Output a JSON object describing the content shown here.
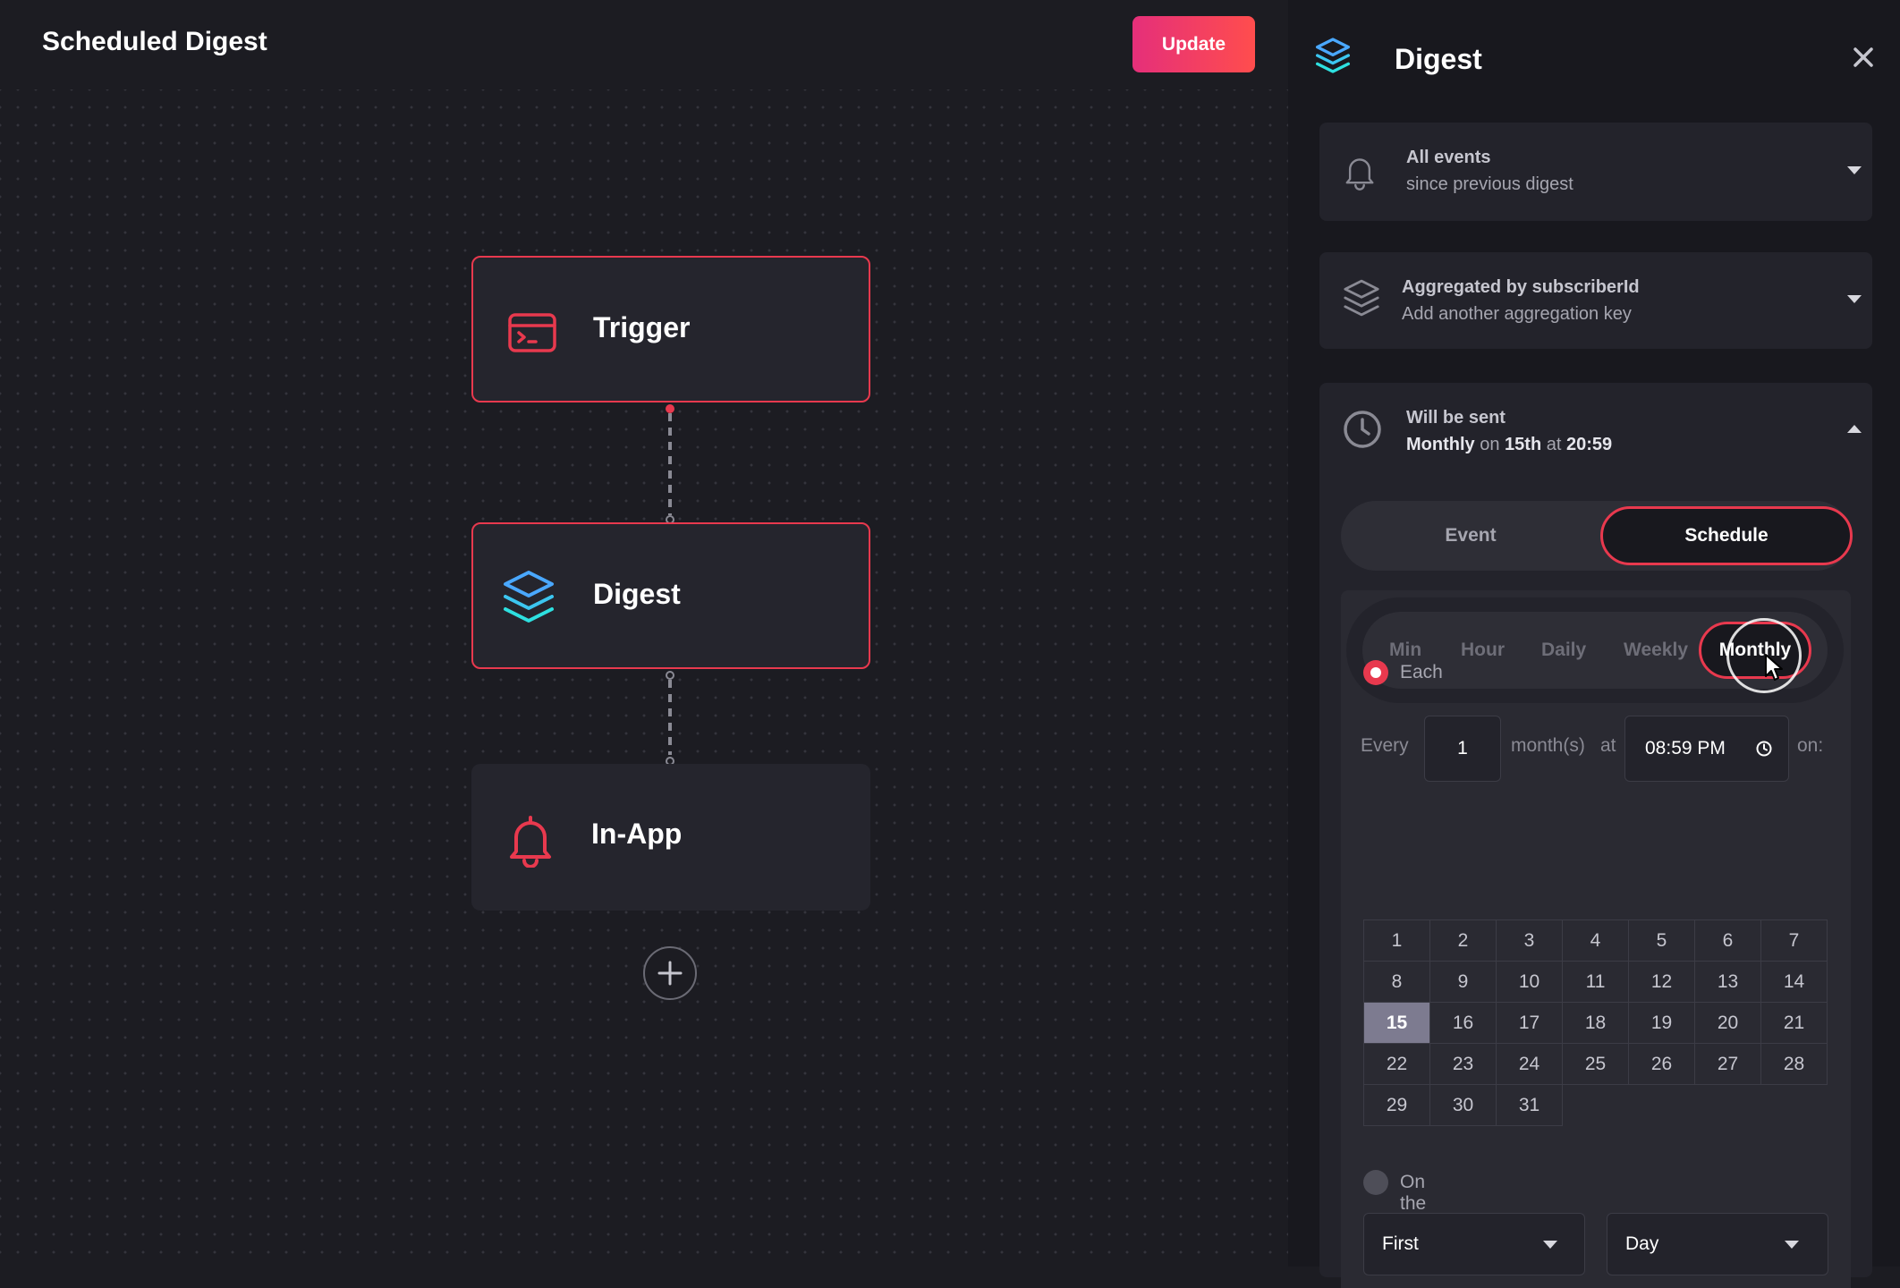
{
  "header": {
    "title": "Scheduled Digest",
    "update_label": "Update"
  },
  "workflow": {
    "nodes": [
      {
        "label": "Trigger",
        "icon": "terminal-icon"
      },
      {
        "label": "Digest",
        "icon": "layers-icon"
      },
      {
        "label": "In-App",
        "icon": "bell-icon"
      }
    ],
    "add_step_icon": "plus-icon"
  },
  "panel": {
    "title": "Digest",
    "icon": "layers-icon",
    "close_icon": "close-icon",
    "events": {
      "title": "All events",
      "subtitle": "since previous digest"
    },
    "aggregation": {
      "title": "Aggregated by subscriberId",
      "subtitle": "Add another aggregation key"
    },
    "schedule": {
      "title": "Will be sent",
      "summary": {
        "frequency": "Monthly",
        "on_word": "on",
        "day": "15th",
        "at_word": "at",
        "time": "20:59"
      },
      "mode_options": [
        "Event",
        "Schedule"
      ],
      "selected_mode": "Schedule",
      "frequencies": [
        "Min",
        "Hour",
        "Daily",
        "Weekly",
        "Monthly"
      ],
      "selected_frequency": "Monthly",
      "every_label": "Every",
      "every_value": "1",
      "unit_label": "month(s)",
      "at_label": "at",
      "time_value": "08:59 PM",
      "on_label": "on:",
      "each_label": "Each",
      "days": [
        "1",
        "2",
        "3",
        "4",
        "5",
        "6",
        "7",
        "8",
        "9",
        "10",
        "11",
        "12",
        "13",
        "14",
        "15",
        "16",
        "17",
        "18",
        "19",
        "20",
        "21",
        "22",
        "23",
        "24",
        "25",
        "26",
        "27",
        "28",
        "29",
        "30",
        "31"
      ],
      "selected_day": "15",
      "on_the_label": "On the",
      "ordinal_value": "First",
      "weekday_value": "Day"
    }
  },
  "colors": {
    "accent": "#e8394e",
    "background": "#1c1c22",
    "panel": "#18181e",
    "card": "#23232b",
    "selected_day": "#7d7b90"
  }
}
